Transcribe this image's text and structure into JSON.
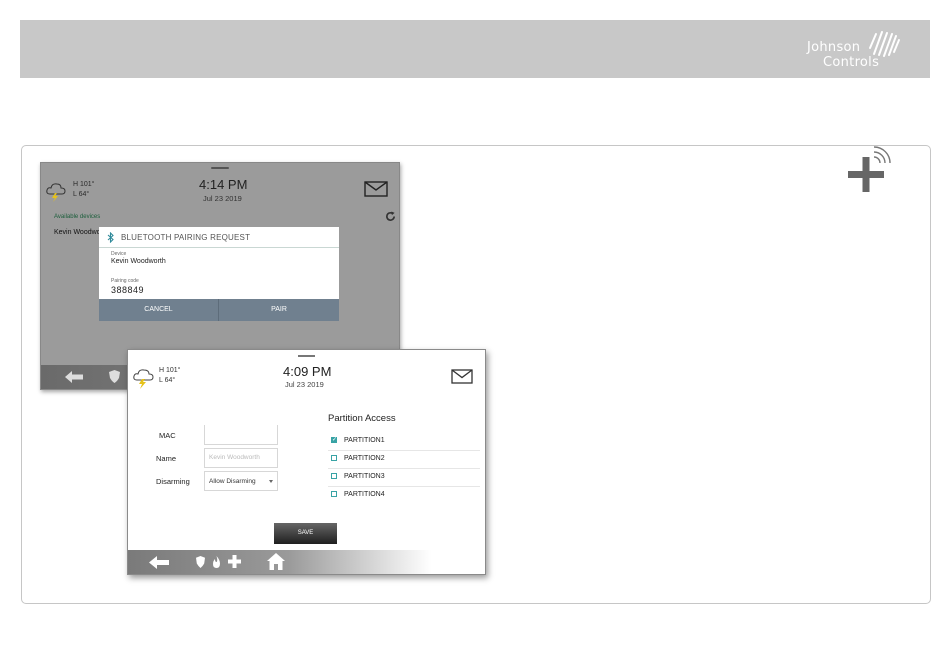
{
  "brand": {
    "line1": "Johnson",
    "line2": "Controls"
  },
  "screen1": {
    "weather": {
      "high": "H 101°",
      "low": "L 64°"
    },
    "clock": {
      "time": "4:14 PM",
      "date": "Jul 23 2019"
    },
    "available_devices_label": "Available devices",
    "device_row": "Kevin Woodwo",
    "dialog": {
      "title": "BLUETOOTH PAIRING REQUEST",
      "device_label": "Device",
      "device_value": "Kevin Woodworth",
      "code_label": "Pairing code",
      "code_value": "388849",
      "cancel_label": "CANCEL",
      "pair_label": "PAIR"
    }
  },
  "screen2": {
    "weather": {
      "high": "H 101°",
      "low": "L 64°"
    },
    "clock": {
      "time": "4:09 PM",
      "date": "Jul 23 2019"
    },
    "form": {
      "mac_label": "MAC",
      "mac_value": "",
      "name_label": "Name",
      "name_placeholder": "Kevin Woodworth",
      "disarming_label": "Disarming",
      "disarming_selected": "Allow Disarming"
    },
    "partition_access": {
      "title": "Partition Access",
      "items": [
        {
          "label": "PARTITION1",
          "checked": true
        },
        {
          "label": "PARTITION2",
          "checked": false
        },
        {
          "label": "PARTITION3",
          "checked": false
        },
        {
          "label": "PARTITION4",
          "checked": false
        }
      ]
    },
    "save_label": "SAVE"
  },
  "colors": {
    "header_bar": "#c8c8c8",
    "dialog_buttons": "#70808f",
    "checkbox_accent": "#38a3a5"
  },
  "icons": [
    "plus-wireless-icon",
    "weather-storm-icon",
    "mail-icon",
    "refresh-icon",
    "bluetooth-icon",
    "back-arrow-icon",
    "shield-icon",
    "fire-icon",
    "medical-plus-icon",
    "home-icon"
  ]
}
